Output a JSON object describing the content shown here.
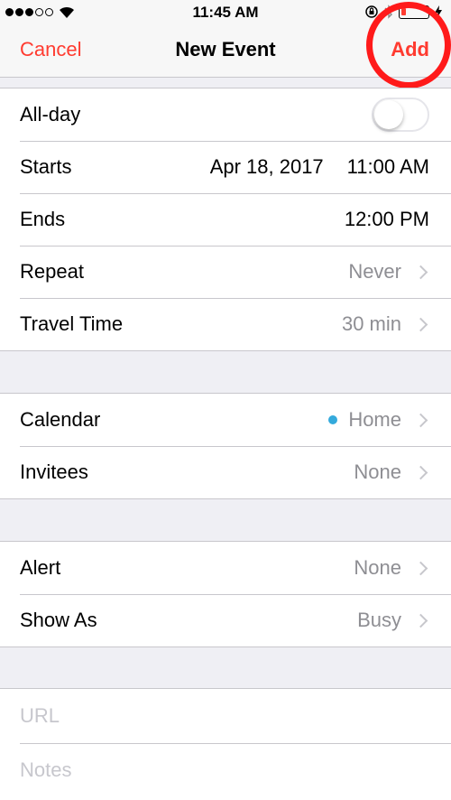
{
  "status": {
    "time": "11:45 AM"
  },
  "nav": {
    "cancel": "Cancel",
    "title": "New Event",
    "add": "Add"
  },
  "section1": {
    "allday": "All-day",
    "starts_label": "Starts",
    "starts_date": "Apr 18, 2017",
    "starts_time": "11:00 AM",
    "ends_label": "Ends",
    "ends_time": "12:00 PM",
    "repeat_label": "Repeat",
    "repeat_value": "Never",
    "travel_label": "Travel Time",
    "travel_value": "30 min"
  },
  "section2": {
    "calendar_label": "Calendar",
    "calendar_value": "Home",
    "invitees_label": "Invitees",
    "invitees_value": "None"
  },
  "section3": {
    "alert_label": "Alert",
    "alert_value": "None",
    "showas_label": "Show As",
    "showas_value": "Busy"
  },
  "section4": {
    "url_placeholder": "URL",
    "notes_placeholder": "Notes"
  },
  "colors": {
    "accent": "#ff3b30",
    "calendar_home": "#34aadc",
    "highlight_circle": "#ff1a1a"
  }
}
